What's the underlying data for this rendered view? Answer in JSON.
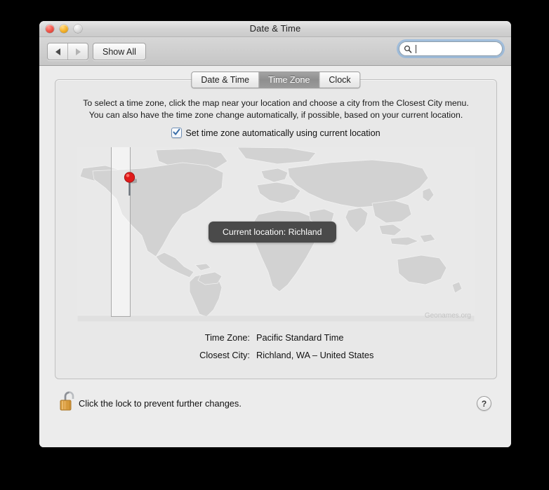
{
  "window": {
    "title": "Date & Time",
    "traffic_lights": [
      "close-button",
      "minimize-button",
      "zoom-button"
    ]
  },
  "toolbar": {
    "back_label": "back-arrow",
    "forward_label": "forward-arrow",
    "show_all_label": "Show All",
    "search": {
      "value": "",
      "placeholder": ""
    }
  },
  "tabs": [
    {
      "label": "Date & Time",
      "active": false
    },
    {
      "label": "Time Zone",
      "active": true
    },
    {
      "label": "Clock",
      "active": false
    }
  ],
  "panel": {
    "instructions_line1": "To select a time zone, click the map near your location and choose a city from the Closest City menu.",
    "instructions_line2": "You can also have the time zone change automatically, if possible, based on your current location.",
    "auto_checkbox": {
      "label": "Set time zone automatically using current location",
      "checked": true
    },
    "map": {
      "callout": "Current location: Richland",
      "attribution": "Geonames.org",
      "pin": "location-pin",
      "highlighted_zone": "Pacific time zone band"
    },
    "info": [
      {
        "label": "Time Zone:",
        "value": "Pacific Standard Time"
      },
      {
        "label": "Closest City:",
        "value": "Richland, WA – United States"
      }
    ]
  },
  "footer": {
    "lock_text": "Click the lock to prevent further changes.",
    "lock_state": "unlocked",
    "help_label": "?"
  },
  "colors": {
    "window_bg": "#ececec",
    "panel_bg": "#e8e8e8",
    "map_land": "#d2d2d2",
    "map_water": "#e9e9e9",
    "pin_red": "#e01b1b",
    "callout_bg": "#4a4a4a",
    "tab_active_bg": "#909090",
    "focus_ring": "#76ace2"
  }
}
